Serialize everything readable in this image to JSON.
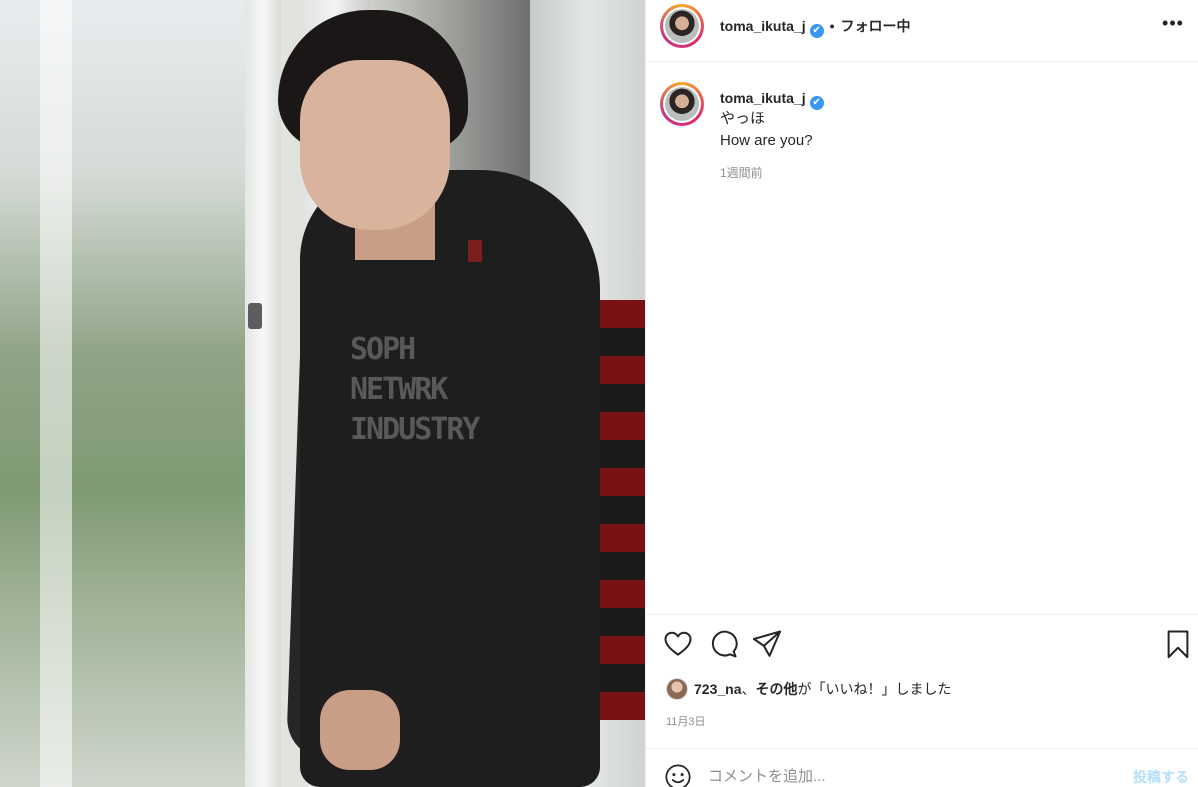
{
  "post": {
    "username": "toma_ikuta_j",
    "verified_glyph": "✔",
    "separator": "•",
    "follow_status": "フォロー中",
    "more_glyph": "•••",
    "caption": {
      "username": "toma_ikuta_j",
      "text": "やっほ\nHow are you?",
      "time_ago": "1週間前"
    },
    "likes": {
      "first_liker": "723_na",
      "sep": "、",
      "others": "その他",
      "suffix": "が「いいね！」しました"
    },
    "date": "11月3日",
    "comment_placeholder": "コメントを追加...",
    "post_button": "投稿する",
    "photo_print_text": "SOPH\nNETWRK\nINDUSTRY"
  },
  "icons": {
    "like": "heart-icon",
    "comment": "comment-icon",
    "share": "paper-plane-icon",
    "save": "bookmark-icon",
    "emoji": "smiley-icon",
    "verified": "verified-badge-icon",
    "more": "more-options-icon"
  },
  "colors": {
    "verified_blue": "#3897f0",
    "muted_text": "#8e8e8e",
    "post_button_disabled": "#b2dffc",
    "divider": "#efefef"
  }
}
